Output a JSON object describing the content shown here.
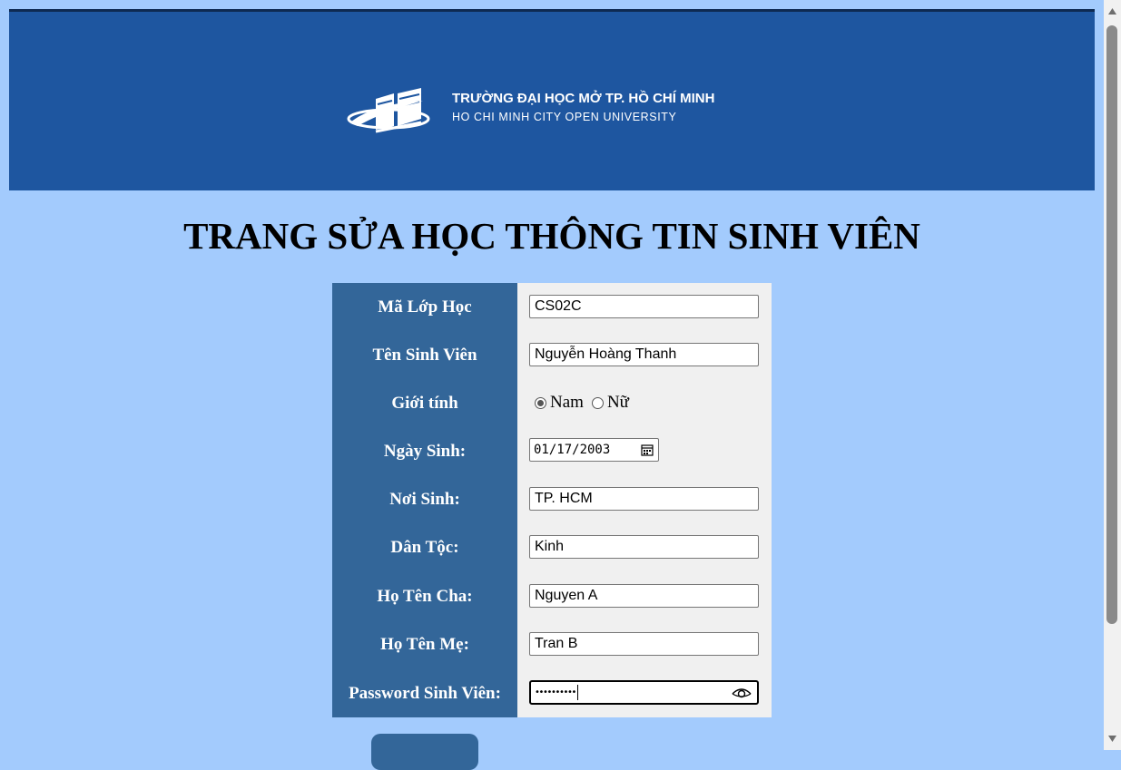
{
  "banner": {
    "logo_title": "TRƯỜNG ĐẠI HỌC MỞ TP. HỒ CHÍ MINH",
    "logo_subtitle": "HO CHI MINH CITY OPEN UNIVERSITY"
  },
  "page_title": "TRANG SỬA HỌC THÔNG TIN SINH VIÊN",
  "form": {
    "ma_lop": {
      "label": "Mã Lớp Học",
      "value": "CS02C"
    },
    "ten_sv": {
      "label": "Tên Sinh Viên",
      "value": "Nguyễn Hoàng Thanh"
    },
    "gioi_tinh": {
      "label": "Giới tính",
      "option_male": "Nam",
      "option_female": "Nữ",
      "selected": "Nam"
    },
    "ngay_sinh": {
      "label": "Ngày Sinh:",
      "value": "01/17/2003"
    },
    "noi_sinh": {
      "label": "Nơi Sinh:",
      "value": "TP. HCM"
    },
    "dan_toc": {
      "label": "Dân Tộc:",
      "value": "Kinh"
    },
    "ho_ten_cha": {
      "label": "Họ Tên Cha:",
      "value": "Nguyen A"
    },
    "ho_ten_me": {
      "label": "Họ Tên Mẹ:",
      "value": "Tran B"
    },
    "password": {
      "label": "Password Sinh Viên:",
      "masked_value": "••••••••••"
    }
  },
  "colors": {
    "page_background": "#a3cbfd",
    "banner": "#1e56a0",
    "label_column": "#336699",
    "input_column": "#f0f0f0"
  },
  "icons": {
    "logo": "open-book-logo-icon",
    "calendar": "calendar-icon",
    "password_toggle": "eye-icon",
    "scroll_up": "scroll-up-arrow-icon",
    "scroll_down": "scroll-down-arrow-icon"
  }
}
